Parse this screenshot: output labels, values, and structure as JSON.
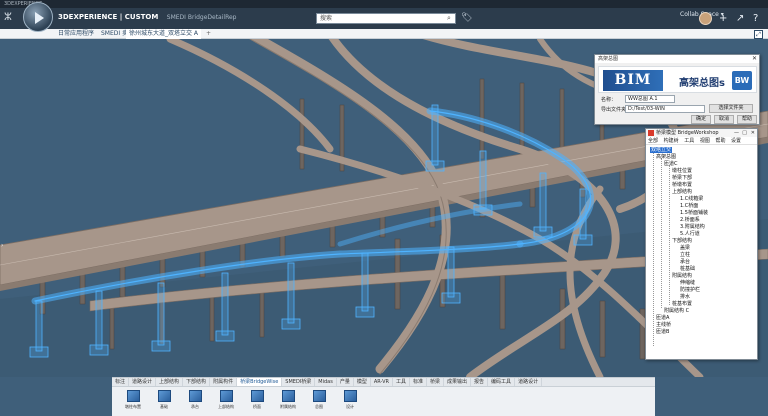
{
  "os_bar": {
    "title": "3DEXPERIENCE"
  },
  "header": {
    "brand": "3DEXPERIENCE",
    "separator": "|",
    "product": "CUSTOM",
    "subtitle": "SMEDI BridgeDetailRep",
    "search_placeholder": "搜索",
    "user_name": "Collab Space ▾"
  },
  "tabs": [
    {
      "label": "日常应用程序"
    },
    {
      "label": "SMEDI 卖"
    },
    {
      "label": "徐州城东大道_双塔立交 A"
    }
  ],
  "export_dialog": {
    "title": "高架总图",
    "banner_logo": "BIM",
    "banner_text": "高架总图s",
    "banner_badge": "BW",
    "name_label": "名称：",
    "name_value": "WW总图 A.1",
    "path_label": "导出文件夹：",
    "path_value": "D:/Test/03-WIN",
    "browse_button": "选择文件夹",
    "ok_button": "确定",
    "cancel_button": "取消",
    "help_button": "帮助"
  },
  "tree_panel": {
    "title": "桥梁模型 BridgeWorkshop",
    "menu": [
      "全部",
      "构建树",
      "工具",
      "视图",
      "帮助",
      "设置"
    ],
    "nodes": [
      "双塔立交",
      "高架总图",
      "匝道C",
      "墩柱位置",
      "桥梁下部",
      "桥墩布置",
      "上部结构",
      "1.C线箱梁",
      "1.C桥面",
      "1.5桥面铺装",
      "2.桥面系",
      "3.附属结构",
      "5.人行道",
      "下部结构",
      "盖梁",
      "立柱",
      "承台",
      "桩基础",
      "附属结构",
      "伸缩缝",
      "防撞护栏",
      "排水",
      "桩基布置",
      "附属结构 C",
      "匝道A",
      "主线桥",
      "匝道B"
    ]
  },
  "action_bar": {
    "tabs": [
      "标注",
      "道路设计",
      "上部结构",
      "下部结构",
      "附属构件",
      "桥梁BridgeWise",
      "SMEDI桥梁",
      "Midas",
      "产量",
      "模型",
      "AR-VR",
      "工具",
      "标准",
      "桥梁",
      "成果输出",
      "报告",
      "编码工具",
      "道路设计"
    ],
    "active_tab": "桥梁BridgeWise",
    "tools": [
      {
        "label": "墩柱布置"
      },
      {
        "label": "基础"
      },
      {
        "label": "承台"
      },
      {
        "label": "上部结构"
      },
      {
        "label": "桥面"
      },
      {
        "label": "附属结构"
      },
      {
        "label": "总图"
      },
      {
        "label": "设计"
      }
    ]
  },
  "colors": {
    "titlebar": "#2c3c4c",
    "viewport_bg": "#3f5f7a",
    "road": "#a7968a",
    "highlight": "#4fb3ff",
    "selection": "#2a6fcf"
  }
}
